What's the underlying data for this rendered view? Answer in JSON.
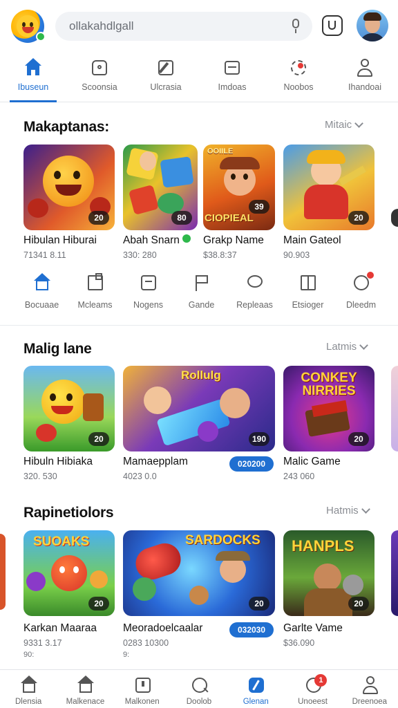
{
  "search": {
    "placeholder": "ollakahdlgall"
  },
  "category_tabs": [
    {
      "label": "Ibuseun",
      "icon": "home-icon",
      "active": true
    },
    {
      "label": "Scoonsia",
      "icon": "bag-icon"
    },
    {
      "label": "Ulcrasia",
      "icon": "edit-icon"
    },
    {
      "label": "Imdoas",
      "icon": "news-icon"
    },
    {
      "label": "Noobos",
      "icon": "settings-icon"
    },
    {
      "label": "Ihandoai",
      "icon": "person-icon"
    }
  ],
  "section1": {
    "title": "Makaptanas:",
    "more": "Mitaic",
    "cards": [
      {
        "name": "Hibulan Hiburai",
        "meta": "71341 8.11",
        "rating": "20"
      },
      {
        "name": "Abah Snarn",
        "meta": "330: 280",
        "rating": "80",
        "verified": true
      },
      {
        "name": "Grakp Name",
        "meta": "$38.8:37",
        "rating": "39",
        "art_text": "CIOPIEAL",
        "top_text": "OOIILE"
      },
      {
        "name": "Main Gateol",
        "meta": "90.903",
        "rating": "20"
      }
    ]
  },
  "quick_actions": [
    {
      "label": "Bocuaae",
      "icon": "home-icon"
    },
    {
      "label": "Mcleams",
      "icon": "puzzle-icon"
    },
    {
      "label": "Nogens",
      "icon": "tablet-icon"
    },
    {
      "label": "Gande",
      "icon": "flag-icon"
    },
    {
      "label": "Repleaas",
      "icon": "chat-icon"
    },
    {
      "label": "Etsioger",
      "icon": "book-icon"
    },
    {
      "label": "Dleedm",
      "icon": "smile-icon"
    }
  ],
  "section2": {
    "title": "Malig lane",
    "more": "Latmis",
    "cards": [
      {
        "name": "Hibuln Hibiaka",
        "meta": "320. 530",
        "rating": "20"
      },
      {
        "name": "Mamaepplam",
        "meta": "4023 0.0",
        "rating": "190",
        "pill": "020200",
        "art_text": "Rollulg"
      },
      {
        "name": "Malic Game",
        "meta": "243 060",
        "rating": "20",
        "art_text": "CONKEY NIRRIES"
      }
    ]
  },
  "section3": {
    "title": "Rapinetiolors",
    "more": "Hatmis",
    "cards": [
      {
        "name": "Karkan Maaraa",
        "meta": "9331 3.17",
        "meta2": "90:",
        "rating": "20",
        "art_text": "SUOAKS"
      },
      {
        "name": "Meoradoelcaalar",
        "meta": "0283 10300",
        "meta2": "9:",
        "rating": "20",
        "pill": "032030",
        "art_text": "SARDOCKS"
      },
      {
        "name": "Garlte Vame",
        "meta": "$36.090",
        "rating": "20",
        "art_text": "HANPLS"
      }
    ]
  },
  "bottom_nav": [
    {
      "label": "Dlensia",
      "icon": "home-icon"
    },
    {
      "label": "Malkenace",
      "icon": "house-icon"
    },
    {
      "label": "Malkonen",
      "icon": "tablet-icon"
    },
    {
      "label": "Doolob",
      "icon": "search-icon"
    },
    {
      "label": "Glenan",
      "icon": "compass-icon",
      "active": true
    },
    {
      "label": "Unoeest",
      "icon": "bell-icon",
      "badge": "1"
    },
    {
      "label": "Dreenoea",
      "icon": "person-icon"
    }
  ],
  "colors": {
    "accent": "#1f6fd1",
    "badge": "#e53935"
  }
}
